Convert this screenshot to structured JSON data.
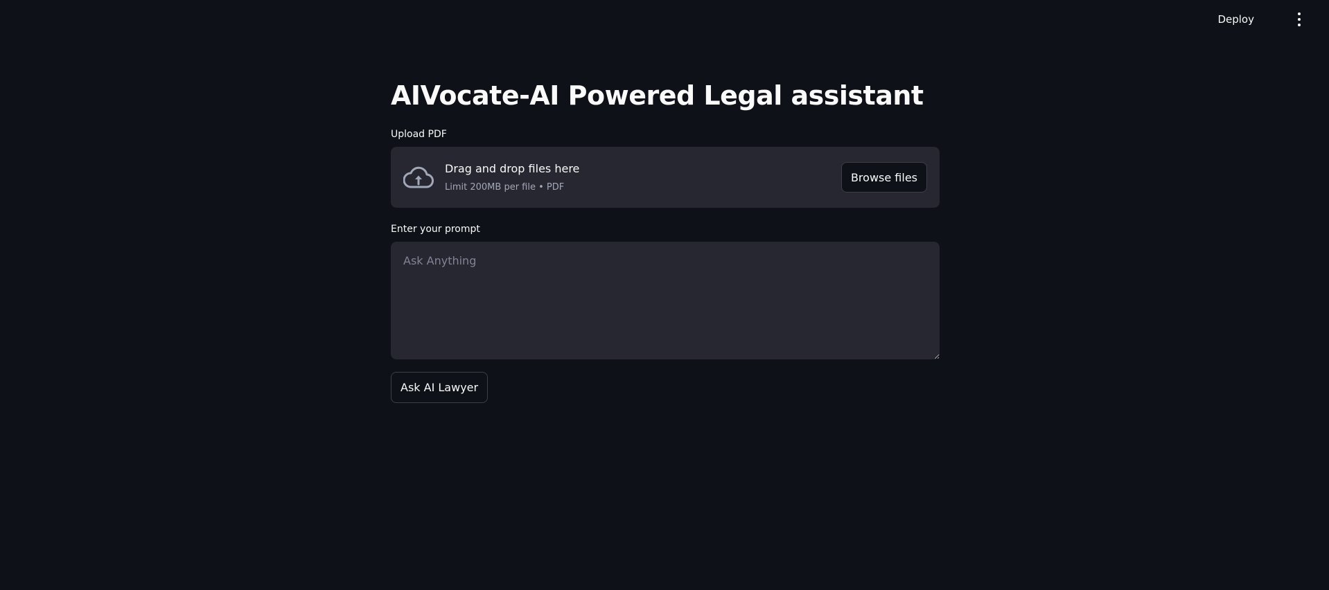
{
  "header": {
    "deploy_label": "Deploy",
    "menu_icon": "kebab-menu-icon"
  },
  "main": {
    "title": "AIVocate-AI Powered Legal assistant",
    "uploader": {
      "label": "Upload PDF",
      "drop_title": "Drag and drop files here",
      "drop_subtitle": "Limit 200MB per file • PDF",
      "browse_label": "Browse files",
      "icon": "cloud-upload-icon"
    },
    "prompt": {
      "label": "Enter your prompt",
      "placeholder": "Ask Anything",
      "value": ""
    },
    "submit_label": "Ask AI Lawyer"
  },
  "colors": {
    "background": "#0e1117",
    "surface": "#262730",
    "text": "#fafafa",
    "muted_text": "#a3a8b8",
    "placeholder": "#808495"
  }
}
